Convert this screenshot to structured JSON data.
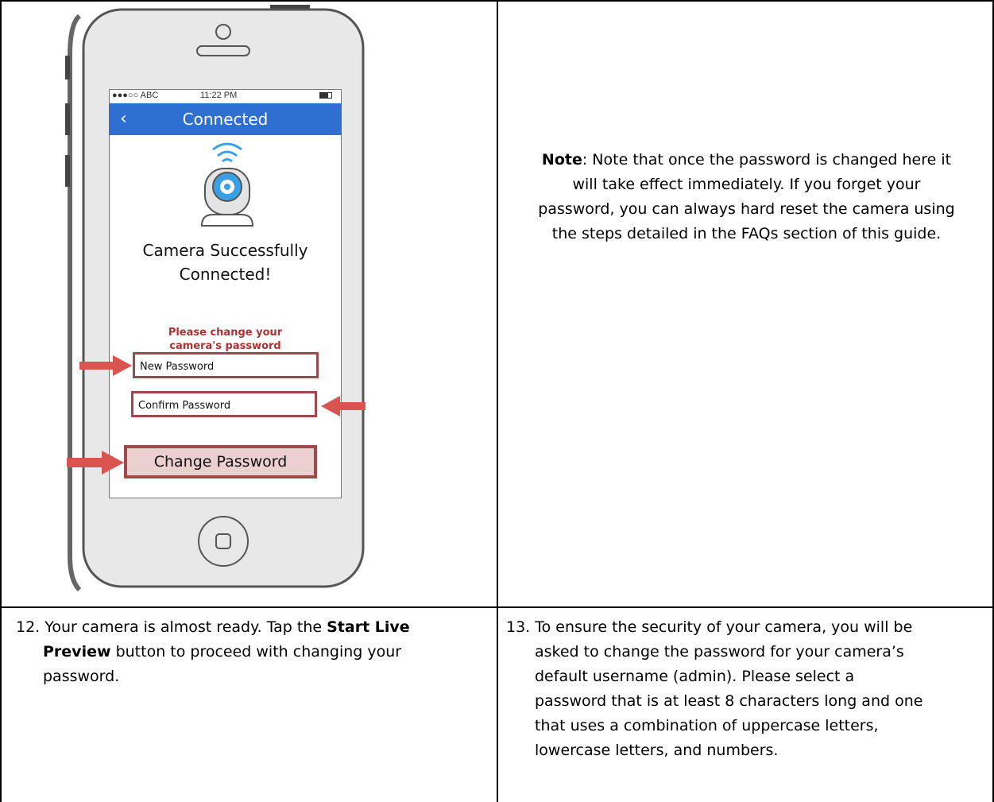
{
  "phone": {
    "status_carrier": "●●●○○ ABC",
    "status_time": "11:22 PM",
    "nav_title": "Connected",
    "nav_back": "‹",
    "success_line1": "Camera Successfully",
    "success_line2": "Connected!",
    "prompt_line1": "Please change your",
    "prompt_line2": "camera's password",
    "new_password_placeholder": "New Password",
    "confirm_password_placeholder": "Confirm Password",
    "change_password_label": "Change Password",
    "colors": {
      "nav": "#2f6fd1",
      "field_border": "#9e4a4a",
      "button_bg": "#eccfcf",
      "arrow": "#d9534f",
      "camera": "#3aa0e6"
    }
  },
  "note": {
    "label": "Note",
    "line1_rest": ": Note that once the password is changed here it",
    "line2": "will take effect immediately. If you forget your",
    "line3": "password, you can always hard reset the camera using",
    "line4": "the steps detailed in the FAQs section of this guide."
  },
  "step12": {
    "line1_pre": "12. Your camera is almost ready. Tap the ",
    "line1_bold": "Start Live",
    "line2_bold": "Preview",
    "line2_rest": " button to proceed with changing your",
    "line3": "password."
  },
  "step13": {
    "line1": "13. To ensure the security of your camera, you will be",
    "line2": "asked to change the password for your camera’s",
    "line3": "default username (admin). Please select a",
    "line4": "password that is at least 8 characters long and one",
    "line5": "that uses a combination of uppercase letters,",
    "line6": "lowercase letters, and numbers."
  }
}
